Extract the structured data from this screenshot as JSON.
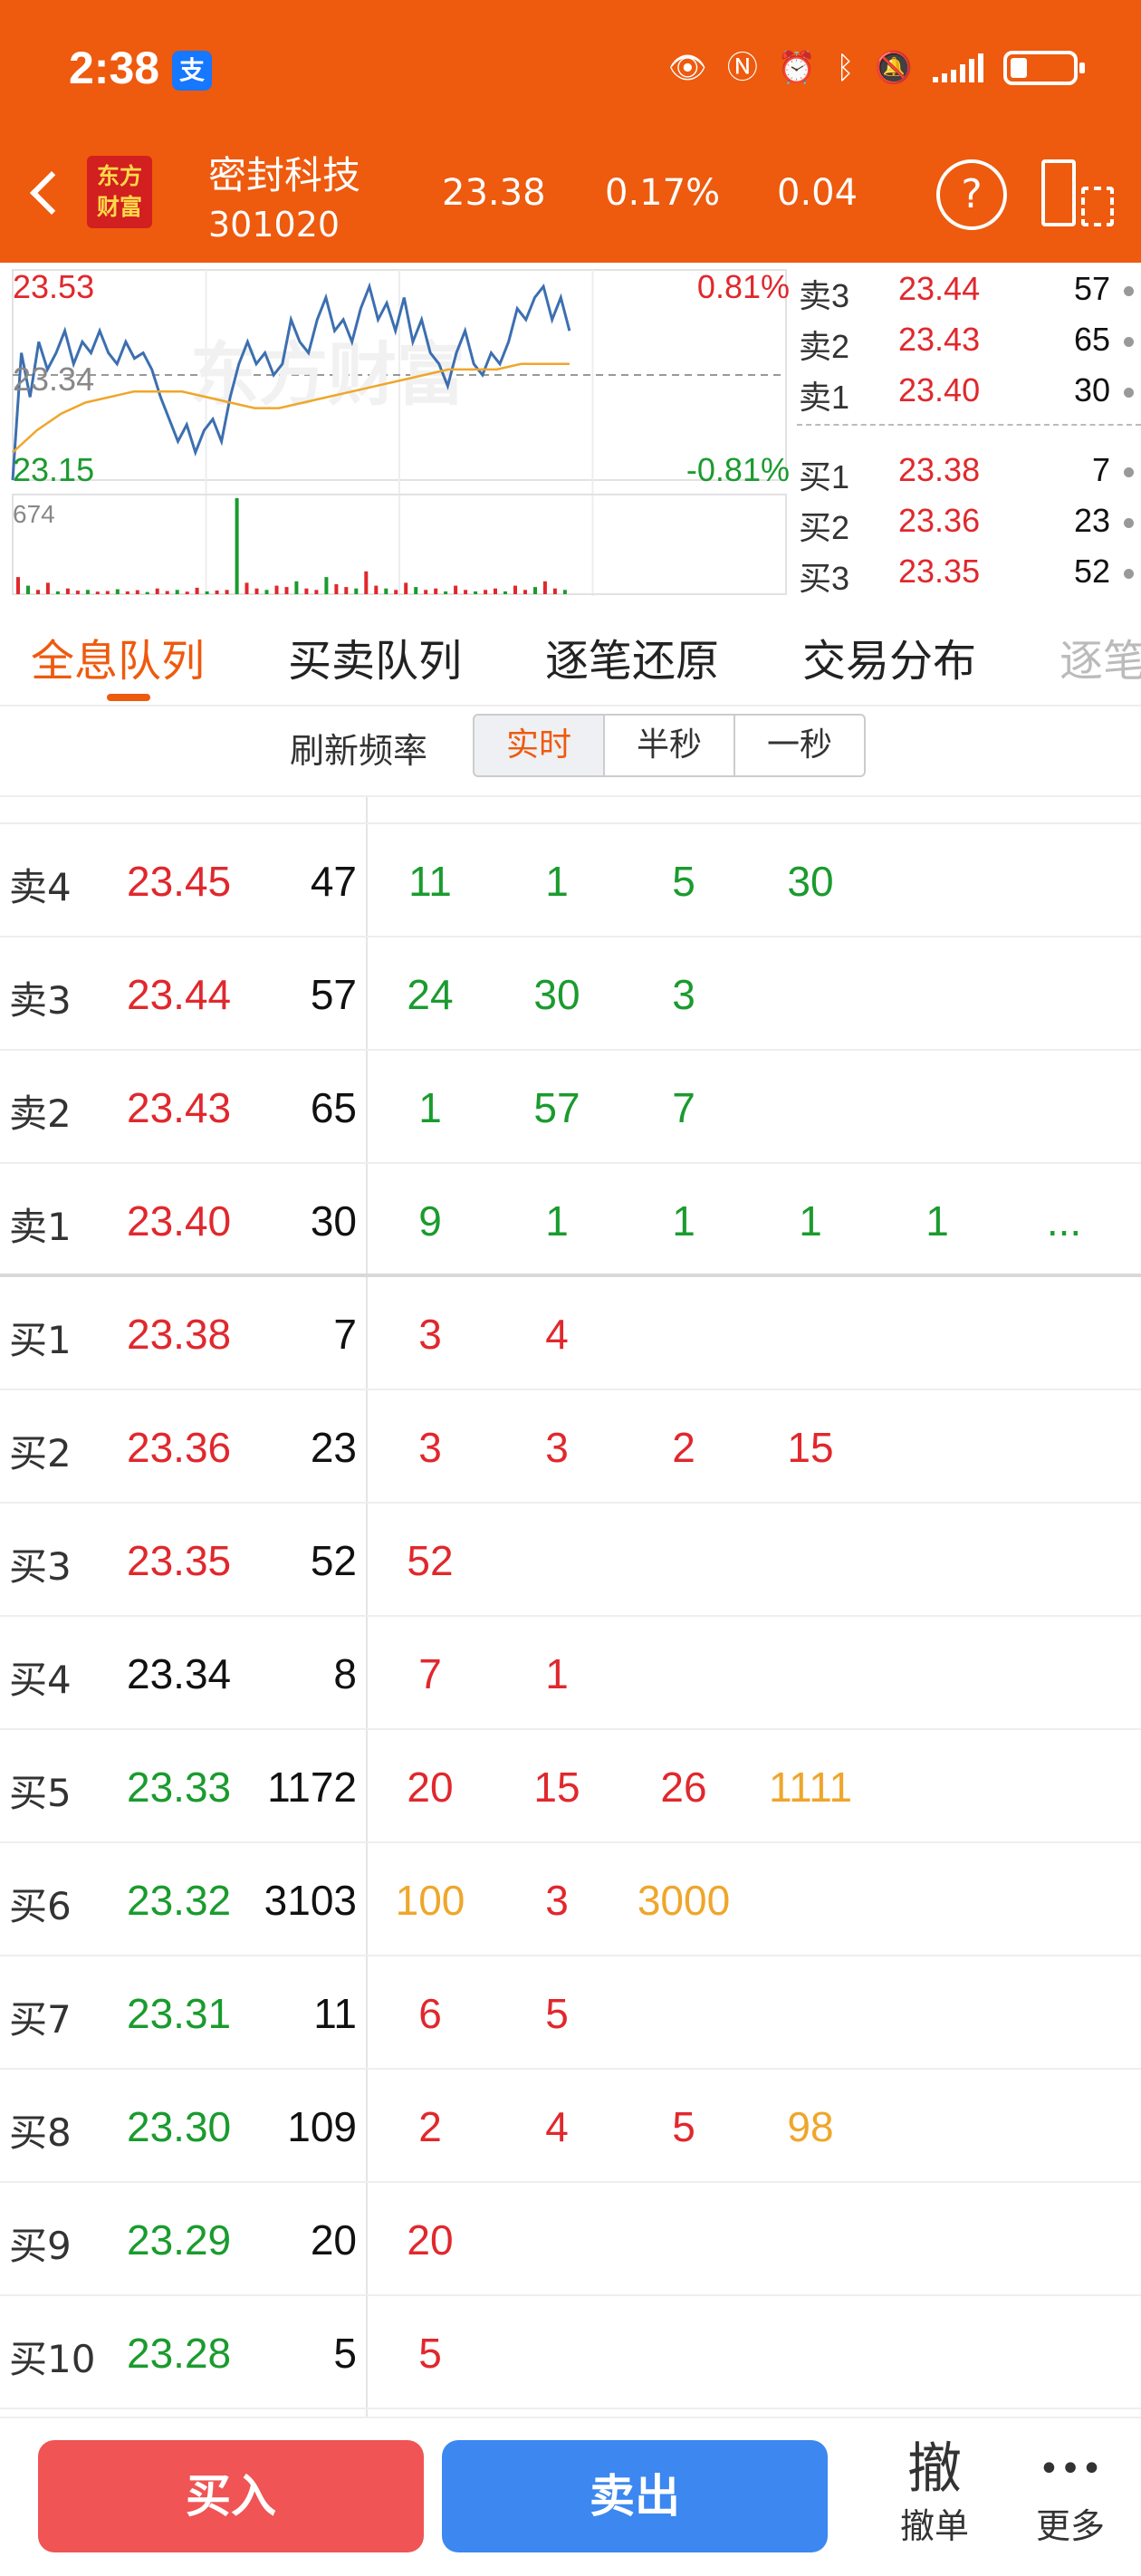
{
  "status_bar": {
    "time": "2:38",
    "alipay_badge": "支"
  },
  "header": {
    "logo_line1": "东方",
    "logo_line2": "财富",
    "stock_name": "密封科技",
    "stock_code": "301020",
    "price": "23.38",
    "change_pct": "0.17%",
    "change": "0.04",
    "help": "?"
  },
  "chart": {
    "max_price": "23.53",
    "mid_price": "23.34",
    "min_price": "23.15",
    "max_pct": "0.81%",
    "min_pct": "-0.81%",
    "volume_max": "674",
    "watermark": "东方财富"
  },
  "chart_data": {
    "type": "line",
    "ylim": [
      23.15,
      23.53
    ],
    "series": [
      {
        "values": [
          23.15,
          23.38,
          23.3,
          23.4,
          23.35,
          23.38,
          23.42,
          23.36,
          23.4,
          23.38,
          23.42,
          23.38,
          23.36,
          23.4,
          23.37,
          23.38,
          23.35,
          23.3,
          23.26,
          23.22,
          23.25,
          23.2,
          23.24,
          23.26,
          23.22,
          23.3,
          23.36,
          23.4,
          23.36,
          23.38,
          23.34,
          23.36,
          23.44,
          23.4,
          23.38,
          23.44,
          23.48,
          23.42,
          23.44,
          23.4,
          23.46,
          23.5,
          23.44,
          23.47,
          23.42,
          23.48,
          23.4,
          23.44,
          23.38,
          23.36,
          23.32,
          23.38,
          23.42,
          23.36,
          23.34,
          23.38,
          23.36,
          23.4,
          23.46,
          23.44,
          23.48,
          23.5,
          23.44,
          23.48,
          23.42
        ]
      },
      {
        "values": [
          23.2,
          23.24,
          23.27,
          23.29,
          23.3,
          23.31,
          23.31,
          23.31,
          23.3,
          23.29,
          23.28,
          23.28,
          23.29,
          23.3,
          23.31,
          23.32,
          23.33,
          23.34,
          23.35,
          23.35,
          23.35,
          23.36,
          23.36,
          23.36
        ]
      }
    ],
    "volume": [
      120,
      60,
      30,
      80,
      20,
      40,
      25,
      30,
      18,
      22,
      35,
      20,
      28,
      15,
      40,
      22,
      30,
      18,
      45,
      20,
      26,
      30,
      674,
      80,
      40,
      30,
      60,
      50,
      90,
      40,
      30,
      120,
      70,
      50,
      40,
      160,
      60,
      40,
      30,
      80,
      50,
      30,
      40,
      20,
      60,
      30,
      20,
      30,
      40,
      20,
      60,
      30,
      50,
      90,
      40,
      30
    ]
  },
  "depth": {
    "asks": [
      {
        "label": "卖3",
        "price": "23.44",
        "vol": "57"
      },
      {
        "label": "卖2",
        "price": "23.43",
        "vol": "65"
      },
      {
        "label": "卖1",
        "price": "23.40",
        "vol": "30"
      }
    ],
    "bids": [
      {
        "label": "买1",
        "price": "23.38",
        "vol": "7"
      },
      {
        "label": "买2",
        "price": "23.36",
        "vol": "23"
      },
      {
        "label": "买3",
        "price": "23.35",
        "vol": "52"
      }
    ]
  },
  "tabs": [
    "全息队列",
    "买卖队列",
    "逐笔还原",
    "交易分布",
    "逐笔"
  ],
  "refresh": {
    "label": "刷新频率",
    "options": [
      "实时",
      "半秒",
      "一秒"
    ]
  },
  "colors": {
    "accent": "#EE5A0E",
    "up": "#E0282D",
    "down": "#1A9B2E",
    "large": "#EFA62B"
  },
  "queue": [
    {
      "level": "卖4",
      "price": "23.45",
      "price_color": "red",
      "vol": "47",
      "orders": [
        {
          "v": "11",
          "c": "green"
        },
        {
          "v": "1",
          "c": "green"
        },
        {
          "v": "5",
          "c": "green"
        },
        {
          "v": "30",
          "c": "green"
        }
      ]
    },
    {
      "level": "卖3",
      "price": "23.44",
      "price_color": "red",
      "vol": "57",
      "orders": [
        {
          "v": "24",
          "c": "green"
        },
        {
          "v": "30",
          "c": "green"
        },
        {
          "v": "3",
          "c": "green"
        }
      ]
    },
    {
      "level": "卖2",
      "price": "23.43",
      "price_color": "red",
      "vol": "65",
      "orders": [
        {
          "v": "1",
          "c": "green"
        },
        {
          "v": "57",
          "c": "green"
        },
        {
          "v": "7",
          "c": "green"
        }
      ]
    },
    {
      "level": "卖1",
      "price": "23.40",
      "price_color": "red",
      "vol": "30",
      "orders": [
        {
          "v": "9",
          "c": "green"
        },
        {
          "v": "1",
          "c": "green"
        },
        {
          "v": "1",
          "c": "green"
        },
        {
          "v": "1",
          "c": "green"
        },
        {
          "v": "1",
          "c": "green"
        },
        {
          "v": "...",
          "c": "green"
        }
      ]
    },
    {
      "level": "买1",
      "price": "23.38",
      "price_color": "red",
      "vol": "7",
      "orders": [
        {
          "v": "3",
          "c": "red"
        },
        {
          "v": "4",
          "c": "red"
        }
      ]
    },
    {
      "level": "买2",
      "price": "23.36",
      "price_color": "red",
      "vol": "23",
      "orders": [
        {
          "v": "3",
          "c": "red"
        },
        {
          "v": "3",
          "c": "red"
        },
        {
          "v": "2",
          "c": "red"
        },
        {
          "v": "15",
          "c": "red"
        }
      ]
    },
    {
      "level": "买3",
      "price": "23.35",
      "price_color": "red",
      "vol": "52",
      "orders": [
        {
          "v": "52",
          "c": "red"
        }
      ]
    },
    {
      "level": "买4",
      "price": "23.34",
      "price_color": "black",
      "vol": "8",
      "orders": [
        {
          "v": "7",
          "c": "red"
        },
        {
          "v": "1",
          "c": "red"
        }
      ]
    },
    {
      "level": "买5",
      "price": "23.33",
      "price_color": "green",
      "vol": "1172",
      "orders": [
        {
          "v": "20",
          "c": "red"
        },
        {
          "v": "15",
          "c": "red"
        },
        {
          "v": "26",
          "c": "red"
        },
        {
          "v": "1111",
          "c": "orange"
        }
      ]
    },
    {
      "level": "买6",
      "price": "23.32",
      "price_color": "green",
      "vol": "3103",
      "orders": [
        {
          "v": "100",
          "c": "orange"
        },
        {
          "v": "3",
          "c": "red"
        },
        {
          "v": "3000",
          "c": "orange"
        }
      ]
    },
    {
      "level": "买7",
      "price": "23.31",
      "price_color": "green",
      "vol": "11",
      "orders": [
        {
          "v": "6",
          "c": "red"
        },
        {
          "v": "5",
          "c": "red"
        }
      ]
    },
    {
      "level": "买8",
      "price": "23.30",
      "price_color": "green",
      "vol": "109",
      "orders": [
        {
          "v": "2",
          "c": "red"
        },
        {
          "v": "4",
          "c": "red"
        },
        {
          "v": "5",
          "c": "red"
        },
        {
          "v": "98",
          "c": "orange"
        }
      ]
    },
    {
      "level": "买9",
      "price": "23.29",
      "price_color": "green",
      "vol": "20",
      "orders": [
        {
          "v": "20",
          "c": "red"
        }
      ]
    },
    {
      "level": "买10",
      "price": "23.28",
      "price_color": "green",
      "vol": "5",
      "orders": [
        {
          "v": "5",
          "c": "red"
        }
      ]
    }
  ],
  "bottom": {
    "buy": "买入",
    "sell": "卖出",
    "cancel_icon": "撤",
    "cancel": "撤单",
    "more_icon": "•••",
    "more": "更多"
  }
}
